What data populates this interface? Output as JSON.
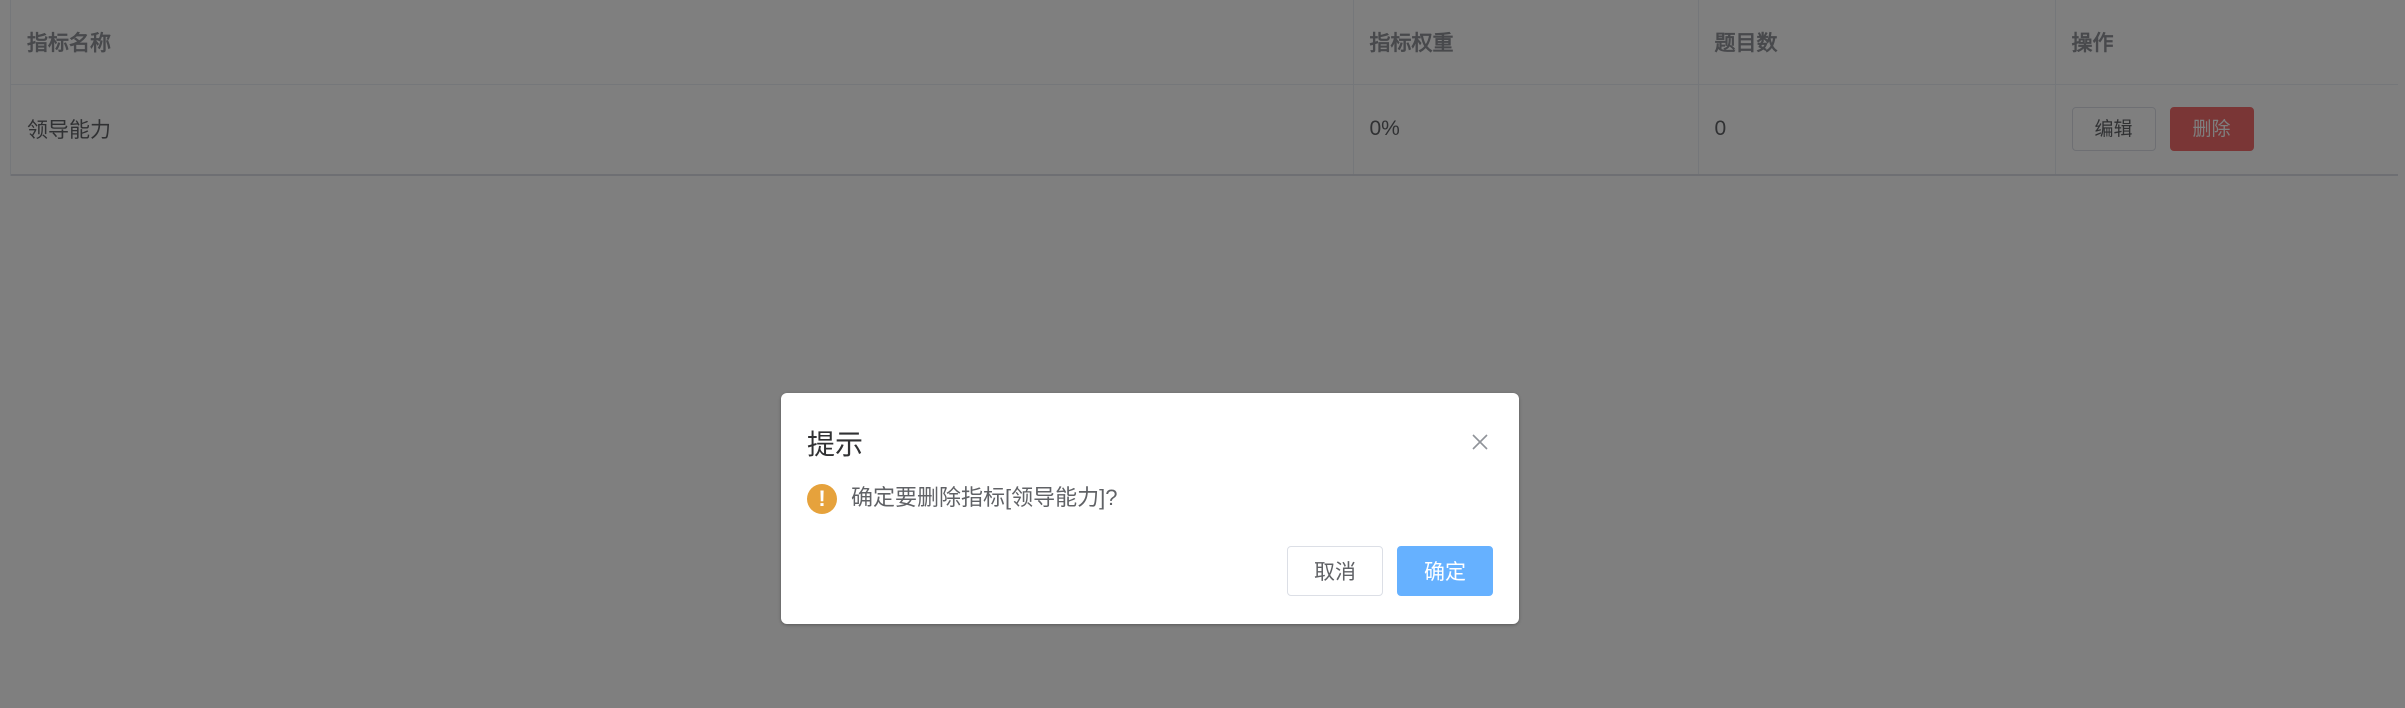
{
  "table": {
    "columns": [
      {
        "key": "name",
        "label": "指标名称"
      },
      {
        "key": "weight",
        "label": "指标权重"
      },
      {
        "key": "count",
        "label": "题目数"
      },
      {
        "key": "action",
        "label": "操作"
      }
    ],
    "rows": [
      {
        "name": "领导能力",
        "weight": "0%",
        "count": "0",
        "edit_label": "编辑",
        "delete_label": "删除"
      }
    ]
  },
  "dialog": {
    "title": "提示",
    "close_icon": "close-icon",
    "warning_icon": "warning-icon",
    "warning_glyph": "!",
    "message": "确定要删除指标[领导能力]?",
    "cancel_label": "取消",
    "confirm_label": "确定"
  },
  "colors": {
    "danger": "#f56c6c",
    "primary": "#66b1ff",
    "warning": "#e6a23c",
    "border": "#ebeef5",
    "text": "#606266",
    "heading": "#909399",
    "overlay": "rgba(0,0,0,0.5)"
  }
}
